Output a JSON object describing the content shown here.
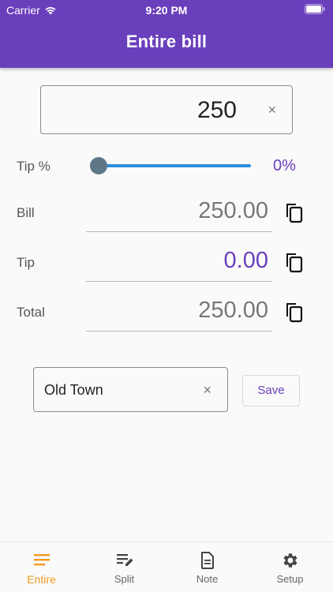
{
  "status_bar": {
    "carrier": "Carrier",
    "time": "9:20 PM"
  },
  "header": {
    "title": "Entire bill"
  },
  "amount_input": {
    "value": "250",
    "clear_icon": "×"
  },
  "tip": {
    "label": "Tip %",
    "percent_display": "0%",
    "slider_value": 0
  },
  "rows": {
    "bill": {
      "label": "Bill",
      "value": "250.00"
    },
    "tip": {
      "label": "Tip",
      "value": "0.00"
    },
    "total": {
      "label": "Total",
      "value": "250.00"
    }
  },
  "note": {
    "value": "Old Town",
    "clear_icon": "×",
    "save_label": "Save"
  },
  "bottom_nav": {
    "items": [
      {
        "label": "Entire",
        "icon": "list-icon",
        "active": true
      },
      {
        "label": "Split",
        "icon": "edit-list-icon",
        "active": false
      },
      {
        "label": "Note",
        "icon": "note-icon",
        "active": false
      },
      {
        "label": "Setup",
        "icon": "gear-icon",
        "active": false
      }
    ]
  },
  "colors": {
    "primary": "#6a3fbb",
    "accent": "#f29a1e",
    "slider": "#2d8de0"
  }
}
